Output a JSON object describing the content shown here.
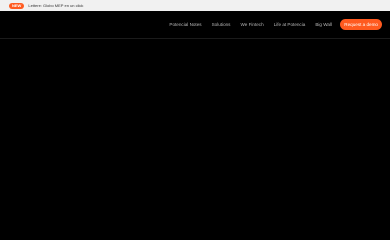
{
  "announcement": {
    "badge": "NEW",
    "text": "Lettere: Globo MEP en un click"
  },
  "nav": {
    "links": [
      "Potencial Notes",
      "Solutions",
      "We Fintech",
      "Life at Potencia",
      "Big Wall"
    ],
    "cta_label": "Request a demo"
  },
  "colors": {
    "accent": "#ff5a1f",
    "background": "#000000",
    "announcement_bg": "#f1f1f1"
  }
}
